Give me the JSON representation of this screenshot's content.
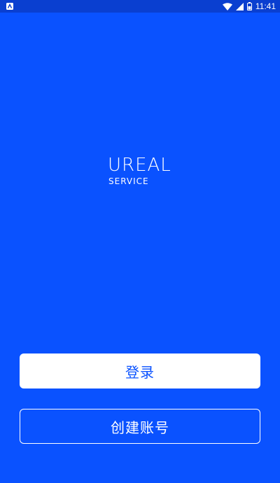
{
  "status_bar": {
    "time": "11:41",
    "icons": [
      "notification-icon",
      "wifi-icon",
      "signal-icon",
      "battery-icon"
    ]
  },
  "logo": {
    "main": "UREAL",
    "sub": "SERVICE"
  },
  "actions": {
    "login_label": "登录",
    "register_label": "创建账号"
  },
  "colors": {
    "background": "#0a52ff",
    "status_bar": "#0a3fd0",
    "button_primary_bg": "#ffffff",
    "button_primary_text": "#0a52ff",
    "button_outline": "#ffffff"
  }
}
